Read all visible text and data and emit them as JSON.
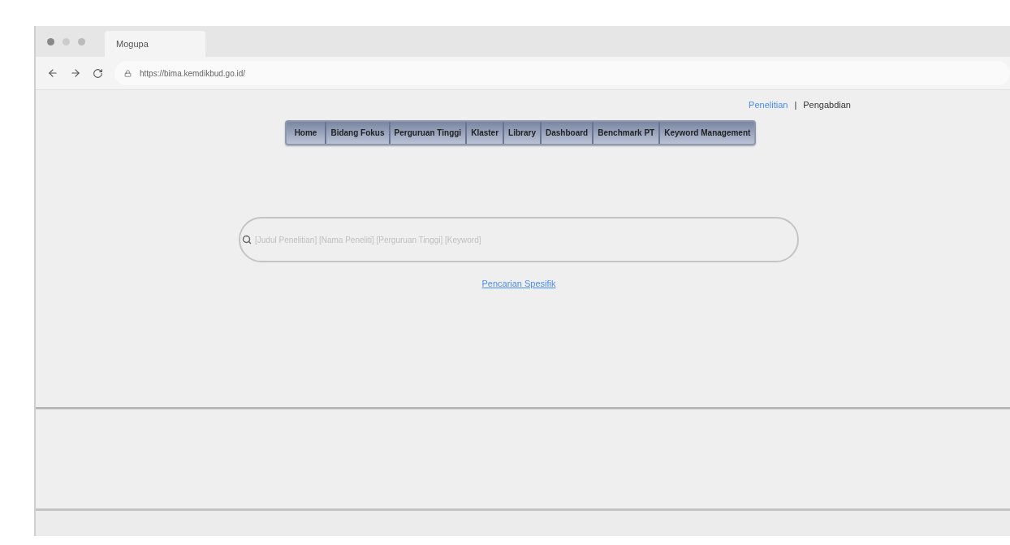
{
  "browser": {
    "tab_title": "Mogupa",
    "url": "https://bima.kemdikbud.go.id/"
  },
  "top_links": [
    {
      "label": "Penelitian",
      "selected": true
    },
    {
      "label": "Pengabdian",
      "selected": false
    }
  ],
  "top_links_separator": "|",
  "menu": [
    "Home",
    "Bidang Fokus",
    "Perguruan Tinggi",
    "Klaster",
    "Library",
    "Dashboard",
    "Benchmark PT",
    "Keyword Management"
  ],
  "search": {
    "placeholder": "[Judul Penelitian] [Nama Peneliti] [Perguruan Tinggi] [Keyword]"
  },
  "specific_search_link": "Pencarian Spesifik"
}
